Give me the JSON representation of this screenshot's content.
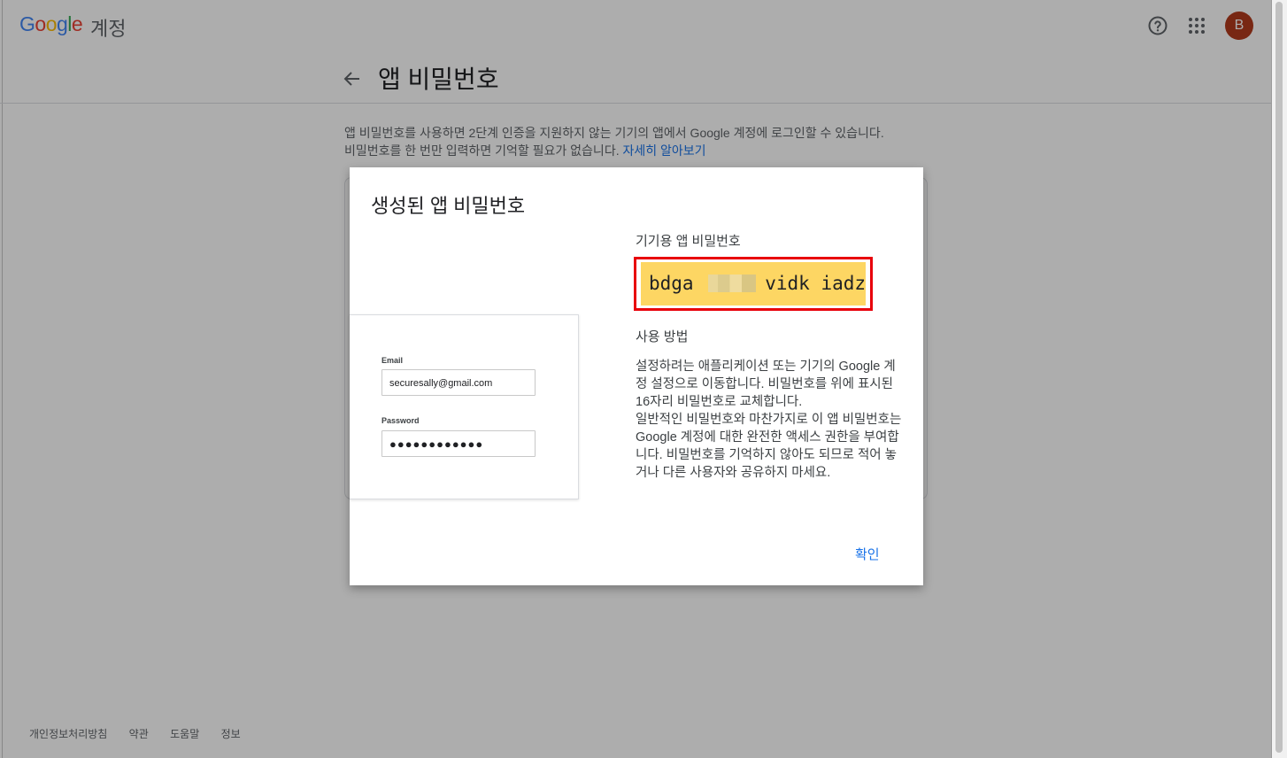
{
  "header": {
    "logo_text": [
      "G",
      "o",
      "o",
      "g",
      "l",
      "e"
    ],
    "logo_suffix": "계정",
    "help_icon": "help-circle-icon",
    "apps_icon": "apps-grid-icon",
    "avatar_initial": "B",
    "avatar_color": "#b23a1c"
  },
  "page": {
    "back_icon": "arrow-back-icon",
    "title": "앱 비밀번호",
    "description_line1": "앱 비밀번호를 사용하면 2단계 인증을 지원하지 않는 기기의 앱에서 Google 계정에 로그인할 수 있습니다.",
    "description_line2": "비밀번호를 한 번만 입력하면 기억할 필요가 없습니다.",
    "learn_more": "자세히 알아보기"
  },
  "footer": {
    "links": [
      "개인정보처리방침",
      "약관",
      "도움말",
      "정보"
    ]
  },
  "dialog": {
    "title": "생성된 앱 비밀번호",
    "device_card": {
      "email_label": "Email",
      "email_value": "securesally@gmail.com",
      "password_label": "Password",
      "password_value": "●●●●●●●●●●●●"
    },
    "password_heading": "기기용 앱 비밀번호",
    "password_part1": "bdga",
    "password_part3": "vidk",
    "password_part4": "iadz",
    "highlight_color": "#fdd663",
    "annotation_color": "#e8000b",
    "usage_heading": "사용 방법",
    "usage_paragraph1": "설정하려는 애플리케이션 또는 기기의 Google 계정 설정으로 이동합니다. 비밀번호를 위에 표시된 16자리 비밀번호로 교체합니다.",
    "usage_paragraph2": "일반적인 비밀번호와 마찬가지로 이 앱 비밀번호는 Google 계정에 대한 완전한 액세스 권한을 부여합니다. 비밀번호를 기억하지 않아도 되므로 적어 놓거나 다른 사용자와 공유하지 마세요.",
    "ok_button": "확인"
  }
}
